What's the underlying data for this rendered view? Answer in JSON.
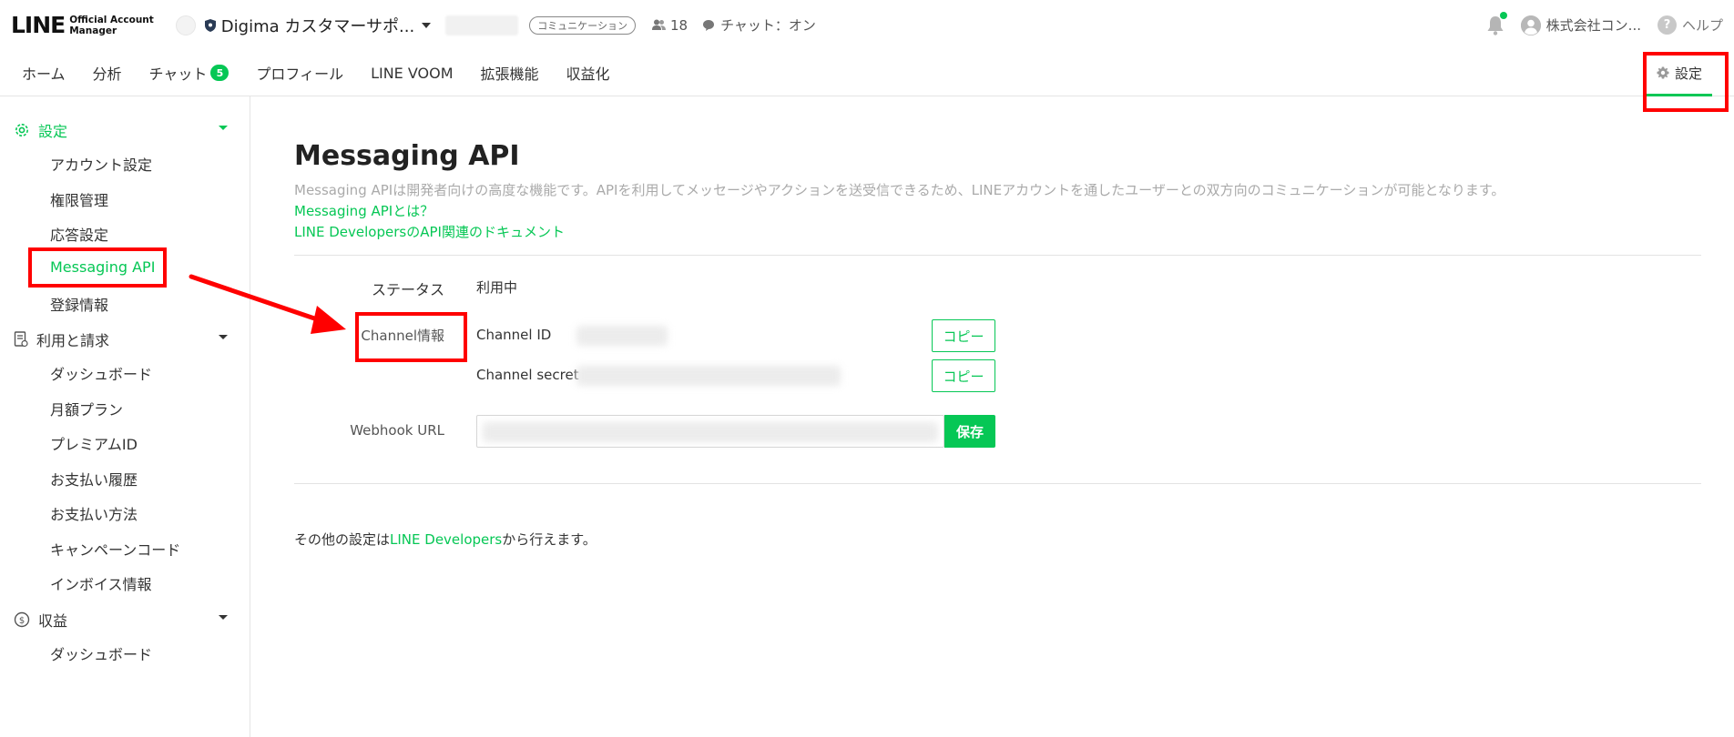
{
  "header": {
    "logo_main": "LINE",
    "logo_sub_1": "Official Account",
    "logo_sub_2": "Manager",
    "account_name": "Digima カスタマーサポ...",
    "account_type_badge": "コミュニケーション",
    "friends_count": "18",
    "chat_status": "チャット：オン",
    "user_name": "株式会社コン...",
    "help_label": "ヘルプ",
    "help_glyph": "?"
  },
  "nav": {
    "items": [
      {
        "label": "ホーム"
      },
      {
        "label": "分析"
      },
      {
        "label": "チャット",
        "badge": "5"
      },
      {
        "label": "プロフィール"
      },
      {
        "label": "LINE VOOM"
      },
      {
        "label": "拡張機能"
      },
      {
        "label": "収益化"
      }
    ],
    "settings_label": "設定"
  },
  "sidebar": {
    "sections": [
      {
        "title": "設定",
        "items": [
          "アカウント設定",
          "権限管理",
          "応答設定",
          "Messaging API",
          "登録情報"
        ]
      },
      {
        "title": "利用と請求",
        "items": [
          "ダッシュボード",
          "月額プラン",
          "プレミアムID",
          "お支払い履歴",
          "お支払い方法",
          "キャンペーンコード",
          "インボイス情報"
        ]
      },
      {
        "title": "収益",
        "items": [
          "ダッシュボード"
        ]
      }
    ]
  },
  "main": {
    "title": "Messaging API",
    "description": "Messaging APIは開発者向けの高度な機能です。APIを利用してメッセージやアクションを送受信できるため、LINEアカウントを通したユーザーとの双方向のコミュニケーションが可能となります。",
    "link_what": "Messaging APIとは？",
    "link_docs": "LINE DevelopersのAPI関連のドキュメント",
    "status_label": "ステータス",
    "status_value": "利用中",
    "channel_label": "Channel情報",
    "channel_id_label": "Channel ID",
    "channel_secret_label": "Channel secret",
    "copy_label": "コピー",
    "webhook_label": "Webhook URL",
    "save_label": "保存",
    "footer_prefix": "その他の設定は",
    "footer_link": "LINE Developers",
    "footer_suffix": "から行えます。"
  },
  "colors": {
    "brand": "#06c755",
    "highlight": "#ff0000"
  }
}
